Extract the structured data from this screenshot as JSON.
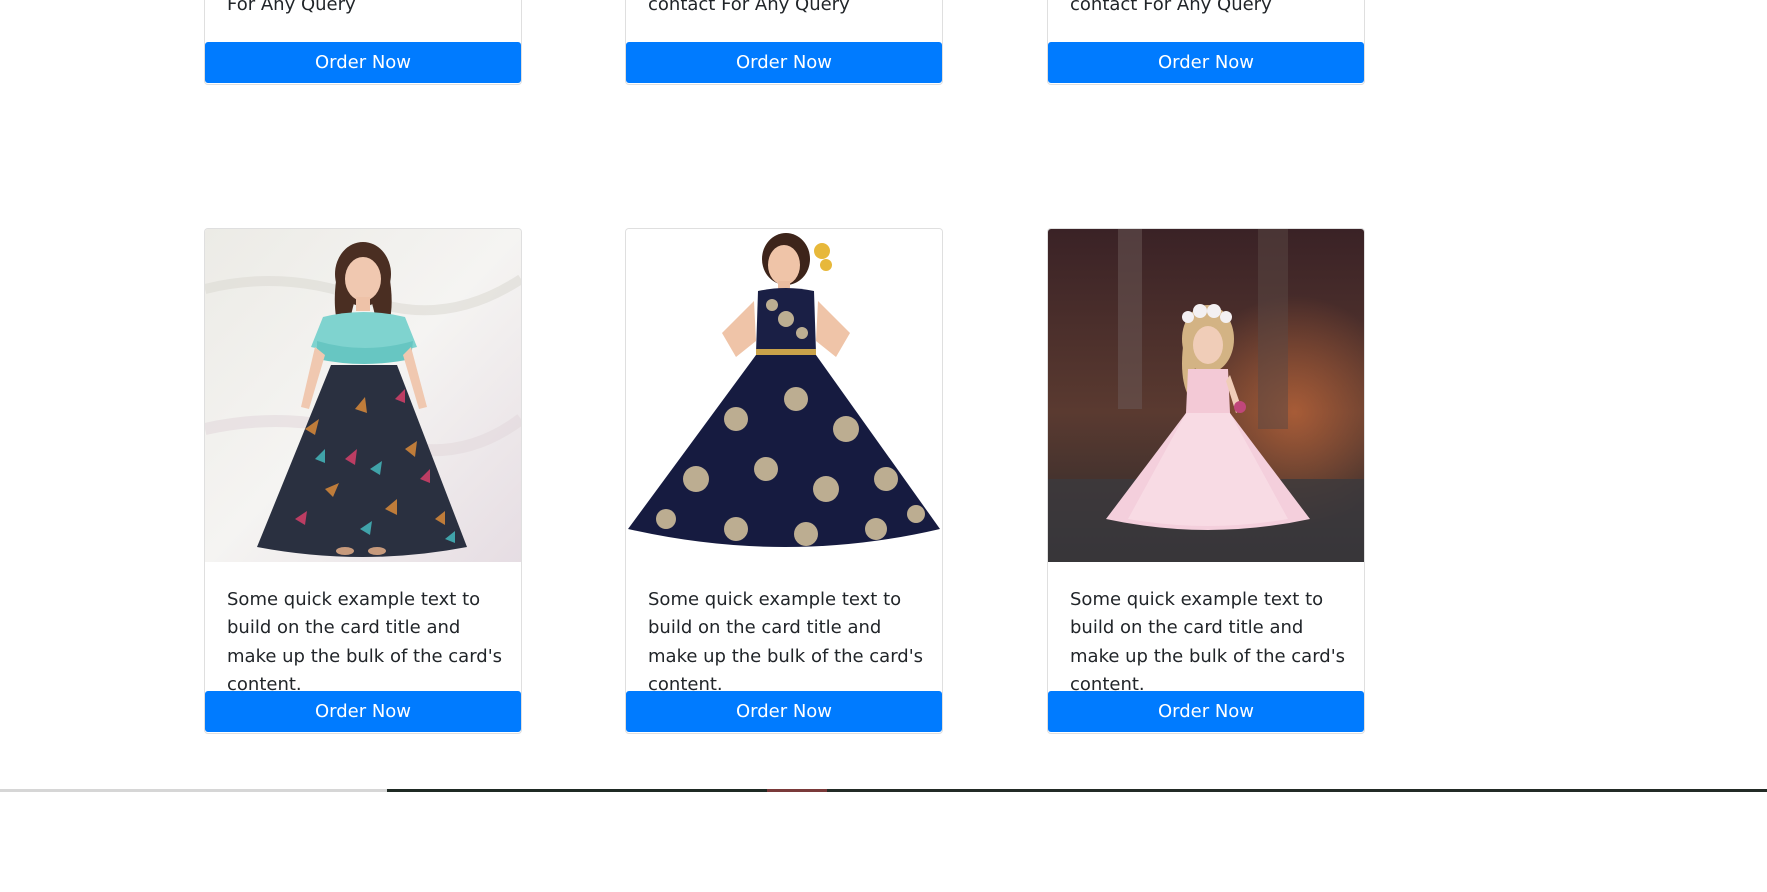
{
  "top_row": [
    {
      "text": "For Any Query",
      "button_label": "Order Now"
    },
    {
      "text": "contact For Any Query",
      "button_label": "Order Now"
    },
    {
      "text": "contact For Any Query",
      "button_label": "Order Now"
    }
  ],
  "bottom_row": [
    {
      "image": "girl-teal-top-floral-skirt-photo",
      "text": "Some quick example text to build on the card title and make up the bulk of the card's content.",
      "button_label": "Order Now"
    },
    {
      "image": "girl-navy-floral-gown-photo",
      "text": "Some quick example text to build on the card title and make up the bulk of the card's content.",
      "button_label": "Order Now"
    },
    {
      "image": "girl-pink-tulle-gown-photo",
      "text": "Some quick example text to build on the card title and make up the bulk of the card's content.",
      "button_label": "Order Now"
    }
  ],
  "colors": {
    "button": "#007bff",
    "button_text": "#ffffff",
    "body_text": "#212529"
  }
}
